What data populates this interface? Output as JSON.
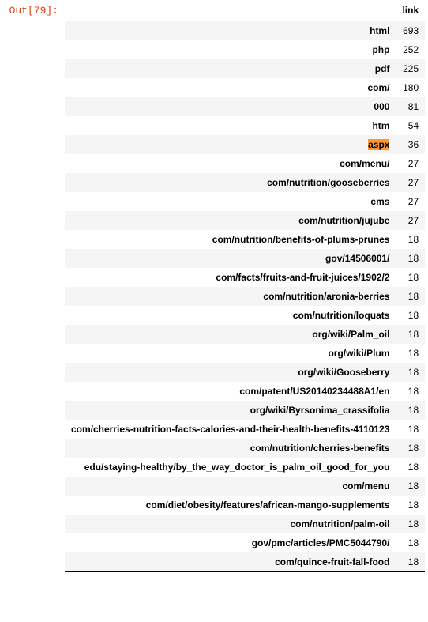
{
  "prompt": "Out[79]:",
  "header": {
    "col": "link"
  },
  "highlighted_index": 6,
  "rows": [
    {
      "index": "html",
      "link": 693
    },
    {
      "index": "php",
      "link": 252
    },
    {
      "index": "pdf",
      "link": 225
    },
    {
      "index": "com/",
      "link": 180
    },
    {
      "index": "000",
      "link": 81
    },
    {
      "index": "htm",
      "link": 54
    },
    {
      "index": "aspx",
      "link": 36
    },
    {
      "index": "com/menu/",
      "link": 27
    },
    {
      "index": "com/nutrition/gooseberries",
      "link": 27
    },
    {
      "index": "cms",
      "link": 27
    },
    {
      "index": "com/nutrition/jujube",
      "link": 27
    },
    {
      "index": "com/nutrition/benefits-of-plums-prunes",
      "link": 18
    },
    {
      "index": "gov/14506001/",
      "link": 18
    },
    {
      "index": "com/facts/fruits-and-fruit-juices/1902/2",
      "link": 18
    },
    {
      "index": "com/nutrition/aronia-berries",
      "link": 18
    },
    {
      "index": "com/nutrition/loquats",
      "link": 18
    },
    {
      "index": "org/wiki/Palm_oil",
      "link": 18
    },
    {
      "index": "org/wiki/Plum",
      "link": 18
    },
    {
      "index": "org/wiki/Gooseberry",
      "link": 18
    },
    {
      "index": "com/patent/US20140234488A1/en",
      "link": 18
    },
    {
      "index": "org/wiki/Byrsonima_crassifolia",
      "link": 18
    },
    {
      "index": "com/cherries-nutrition-facts-calories-and-their-health-benefits-4110123",
      "link": 18
    },
    {
      "index": "com/nutrition/cherries-benefits",
      "link": 18
    },
    {
      "index": "edu/staying-healthy/by_the_way_doctor_is_palm_oil_good_for_you",
      "link": 18
    },
    {
      "index": "com/menu",
      "link": 18
    },
    {
      "index": "com/diet/obesity/features/african-mango-supplements",
      "link": 18
    },
    {
      "index": "com/nutrition/palm-oil",
      "link": 18
    },
    {
      "index": "gov/pmc/articles/PMC5044790/",
      "link": 18
    },
    {
      "index": "com/quince-fruit-fall-food",
      "link": 18
    }
  ]
}
